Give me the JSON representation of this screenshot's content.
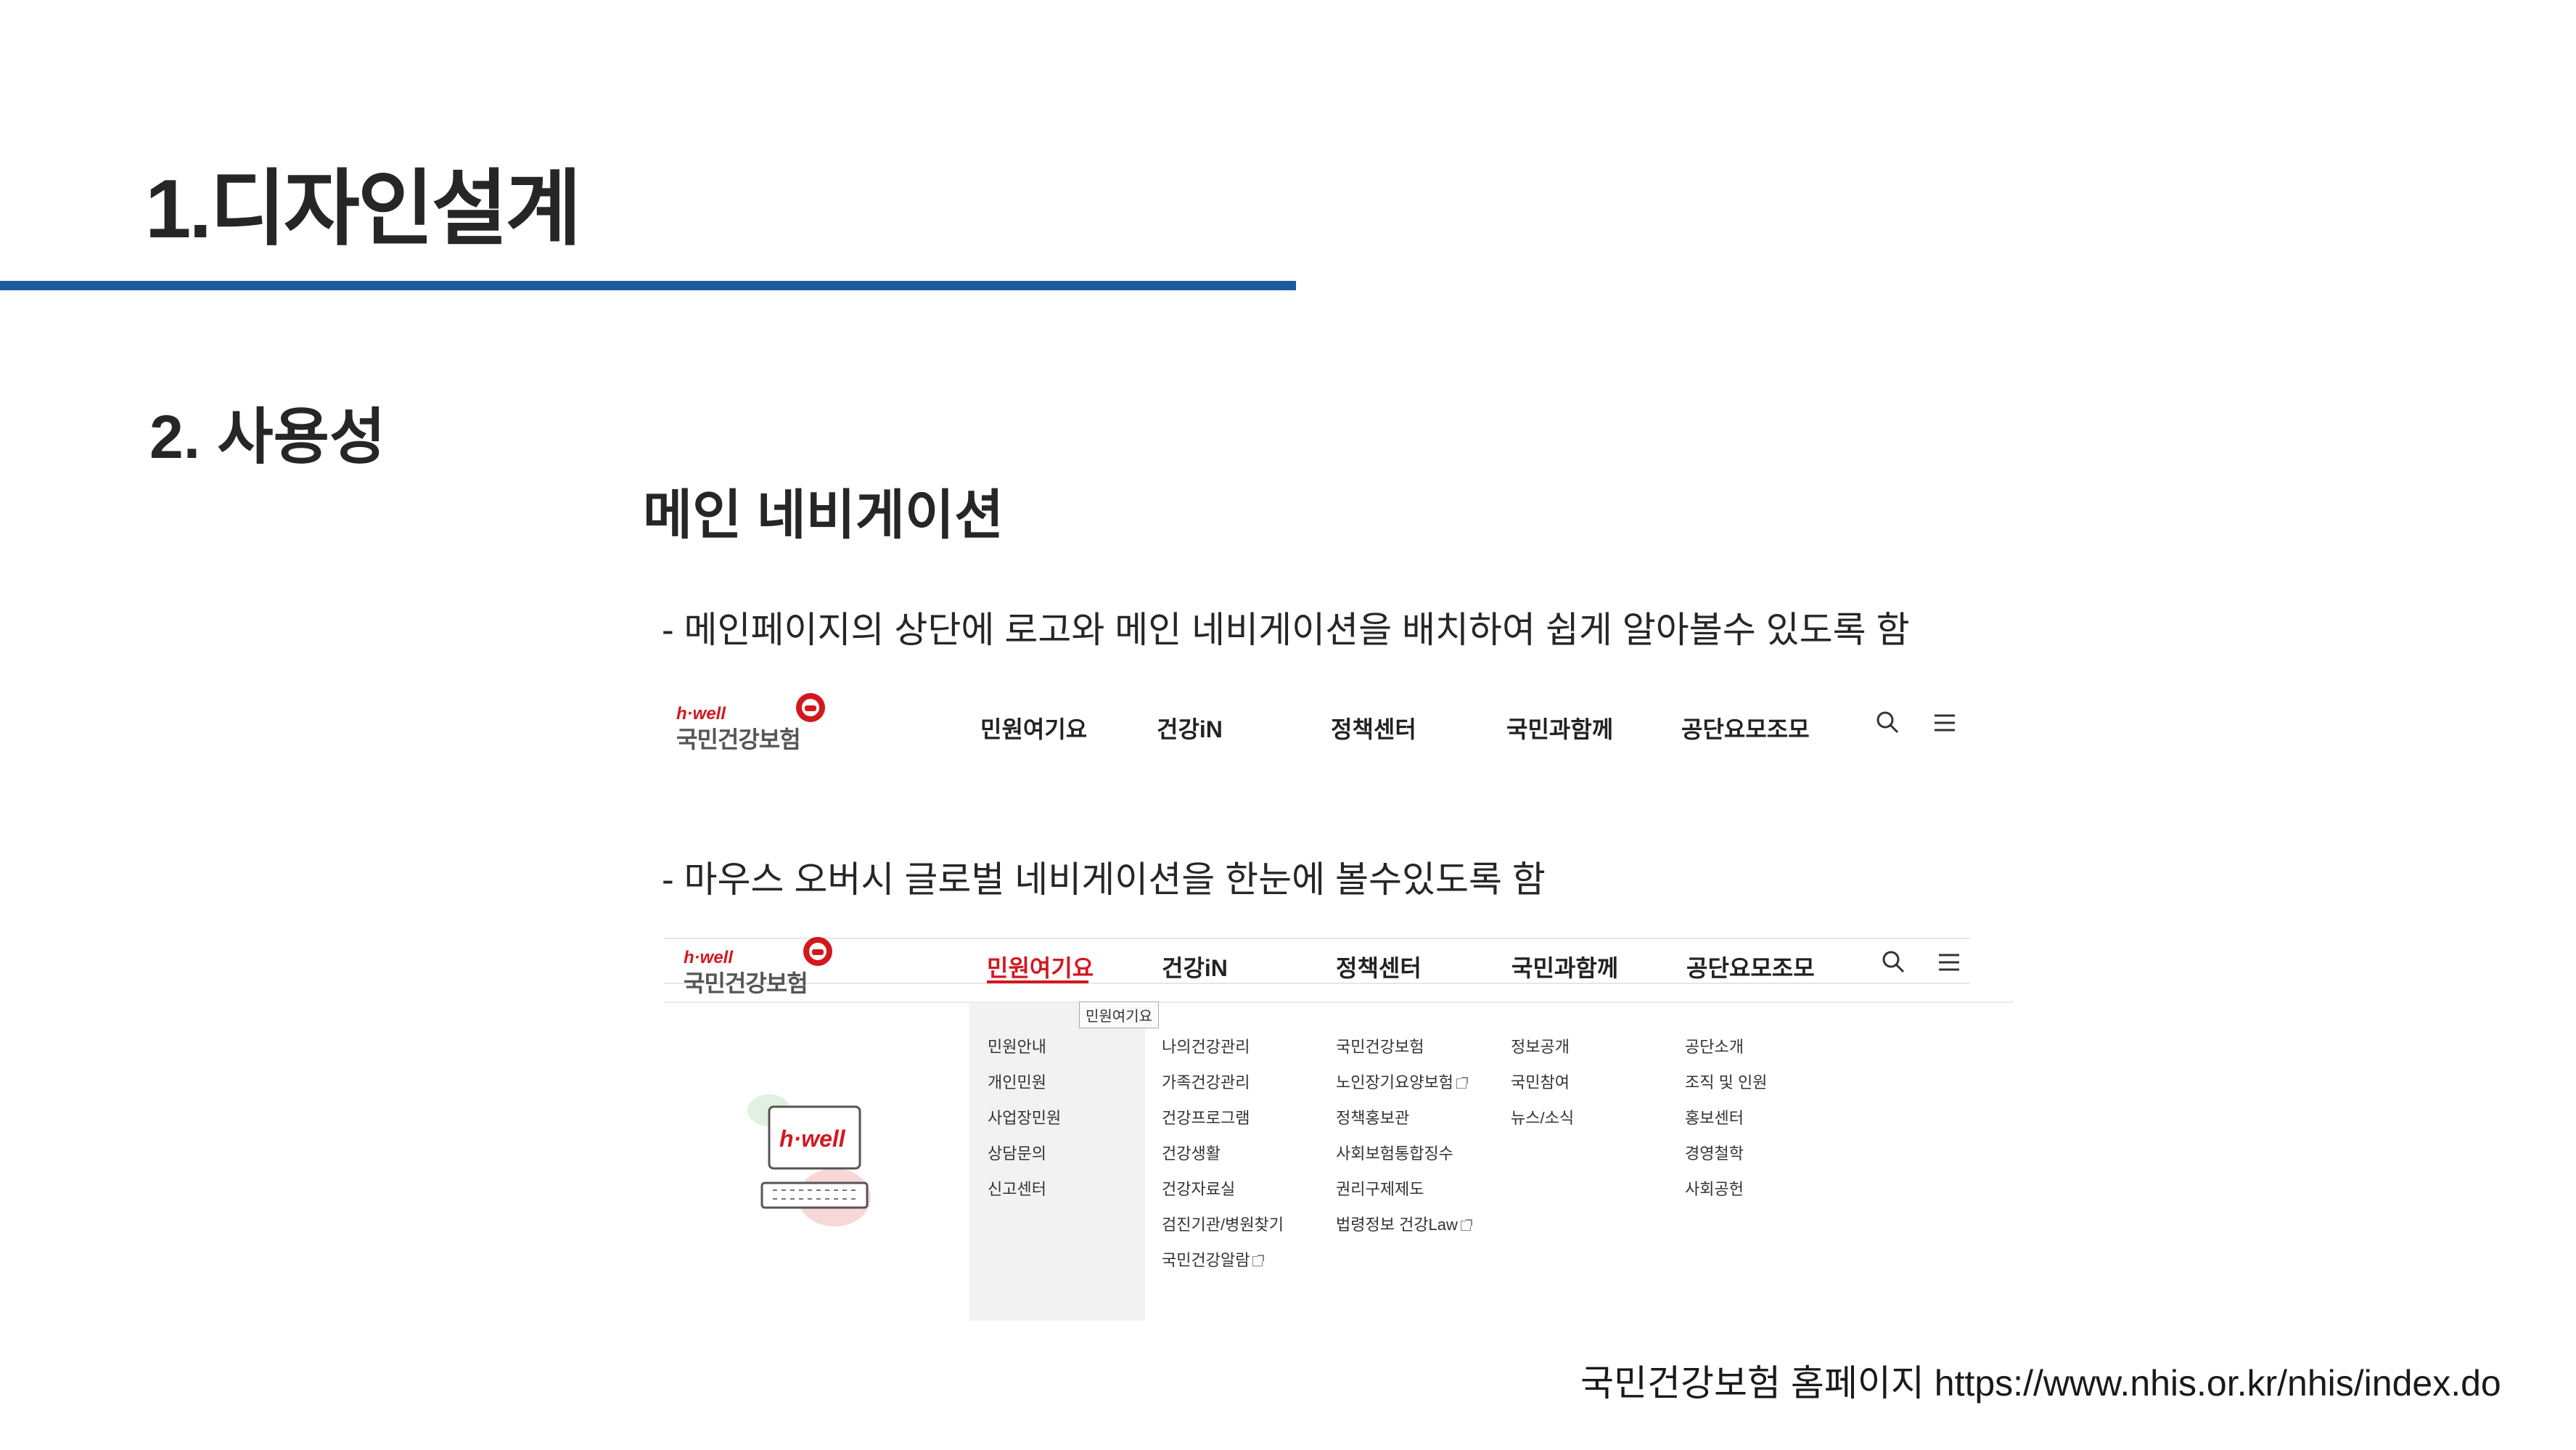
{
  "slide": {
    "main_title": "1.디자인설계",
    "section_title": "2. 사용성",
    "sub_title": "메인 네비게이션",
    "desc1": "- 메인페이지의 상단에 로고와 메인 네비게이션을 배치하여 쉽게 알아볼수 있도록 함",
    "desc2": "- 마우스 오버시 글로벌 네비게이션을 한눈에 볼수있도록 함",
    "footer": "국민건강보험 홈페이지  https://www.nhis.or.kr/nhis/index.do",
    "accent_color": "#1c5aa0"
  },
  "site": {
    "logo_hwell": "h·well",
    "logo_name": "국민건강보험",
    "brand_color": "#d3171e",
    "nav": [
      "민원여기요",
      "건강iN",
      "정책센터",
      "국민과함께",
      "공단요모조모"
    ],
    "icons": [
      "search-icon",
      "menu-icon"
    ]
  },
  "mega": {
    "tooltip": "민원여기요",
    "illustration_text": "h·well",
    "columns": [
      [
        "민원안내",
        "개인민원",
        "사업장민원",
        "상담문의",
        "신고센터"
      ],
      [
        "나의건강관리",
        "가족건강관리",
        "건강프로그램",
        "건강생활",
        "건강자료실",
        "검진기관/병원찾기",
        "국민건강알람"
      ],
      [
        "국민건강보험",
        "노인장기요양보험",
        "정책홍보관",
        "사회보험통합징수",
        "권리구제제도",
        "법령정보 건강Law"
      ],
      [
        "정보공개",
        "국민참여",
        "뉴스/소식"
      ],
      [
        "공단소개",
        "조직 및 인원",
        "홍보센터",
        "경영철학",
        "사회공헌"
      ]
    ]
  }
}
